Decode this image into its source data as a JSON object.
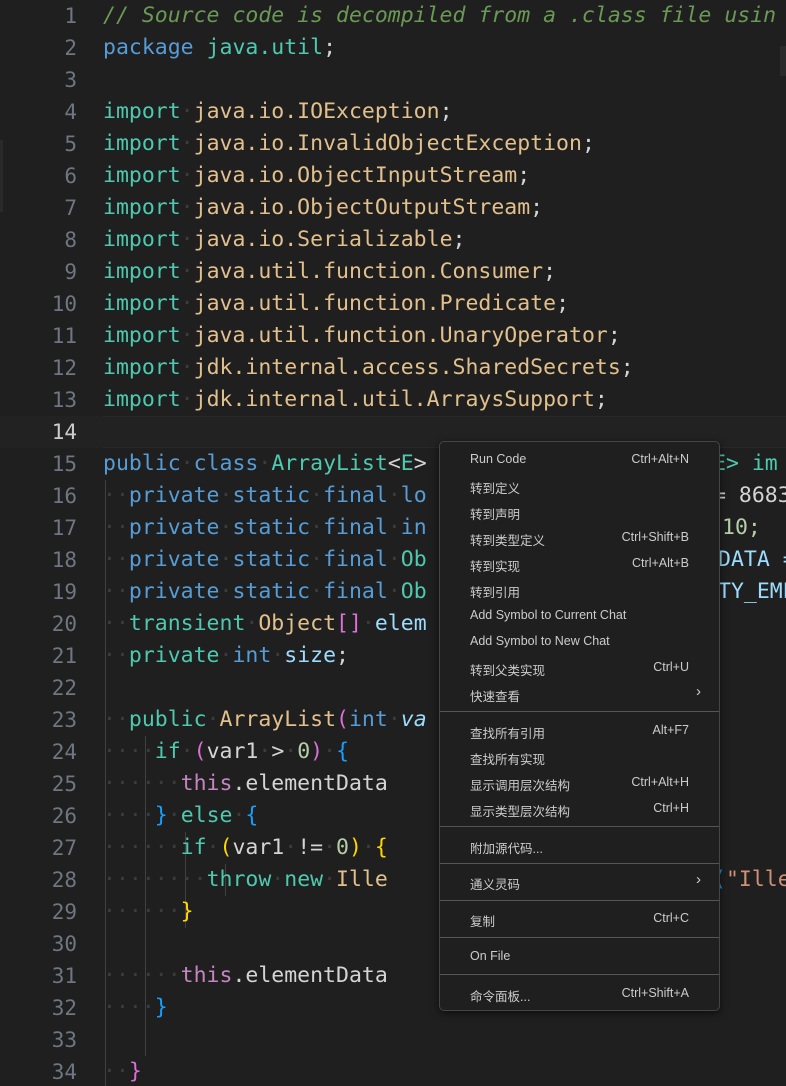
{
  "editor": {
    "line_numbers": [
      "1",
      "2",
      "3",
      "4",
      "5",
      "6",
      "7",
      "8",
      "9",
      "10",
      "11",
      "12",
      "13",
      "14",
      "15",
      "16",
      "17",
      "18",
      "19",
      "20",
      "21",
      "22",
      "23",
      "24",
      "25",
      "26",
      "27",
      "28",
      "29",
      "30",
      "31",
      "32",
      "33",
      "34"
    ],
    "current_line": "14",
    "code": {
      "l1": "// Source code is decompiled from a .class file usin",
      "pkg_kw": "package",
      "pkg_name": "java.util",
      "semi": ";",
      "import_kw": "import",
      "imports": [
        "java.io.IOException",
        "java.io.InvalidObjectException",
        "java.io.ObjectInputStream",
        "java.io.ObjectOutputStream",
        "java.io.Serializable",
        "java.util.function.Consumer",
        "java.util.function.Predicate",
        "java.util.function.UnaryOperator",
        "jdk.internal.access.SharedSecrets",
        "jdk.internal.util.ArraysSupport"
      ],
      "public": "public",
      "class": "class",
      "class_name": "ArrayList",
      "lt": "<",
      "E": "E",
      "gt": ">",
      "tail15": "E> im",
      "private": "private",
      "static": "static",
      "final": "final",
      "l16_type": "lo",
      "l16_tail": "= 8683",
      "l17_type": "in",
      "l17_tail": "10;",
      "l18_type": "Ob",
      "l18_tail": "DATA =",
      "l19_type": "Ob",
      "l19_tail": "TY_EMP",
      "transient": "transient",
      "object": "Object",
      "brackets": "[]",
      "elem": "elem",
      "int": "int",
      "size": "size",
      "ctor": "ArrayList",
      "paren_open": "(",
      "va": "va",
      "if": "if",
      "var1": "var1",
      "gt_op": ">",
      "zero": "0",
      "close_paren": ")",
      "brace_open": "{",
      "brace_close": "}",
      "this": "this",
      "element_data": ".elementData",
      "else": "else",
      "ne_op": "!=",
      "throw": "throw",
      "new": "new",
      "ille": "Ille",
      "tail28_br": "(",
      "tail28_str": "\"Ille"
    }
  },
  "context_menu": {
    "items": [
      {
        "label": "Run Code",
        "shortcut": "Ctrl+Alt+N"
      },
      {
        "label": "转到定义",
        "shortcut": ""
      },
      {
        "label": "转到声明",
        "shortcut": ""
      },
      {
        "label": "转到类型定义",
        "shortcut": "Ctrl+Shift+B"
      },
      {
        "label": "转到实现",
        "shortcut": "Ctrl+Alt+B"
      },
      {
        "label": "转到引用",
        "shortcut": ""
      },
      {
        "label": "Add Symbol to Current Chat",
        "shortcut": ""
      },
      {
        "label": "Add Symbol to New Chat",
        "shortcut": ""
      },
      {
        "label": "转到父类实现",
        "shortcut": "Ctrl+U"
      },
      {
        "label": "快速查看",
        "shortcut": ""
      },
      {
        "label": "查找所有引用",
        "shortcut": "Alt+F7"
      },
      {
        "label": "查找所有实现",
        "shortcut": ""
      },
      {
        "label": "显示调用层次结构",
        "shortcut": "Ctrl+Alt+H"
      },
      {
        "label": "显示类型层次结构",
        "shortcut": "Ctrl+H"
      },
      {
        "label": "附加源代码...",
        "shortcut": ""
      },
      {
        "label": "通义灵码",
        "shortcut": ""
      },
      {
        "label": "复制",
        "shortcut": "Ctrl+C"
      },
      {
        "label": "On File",
        "shortcut": ""
      },
      {
        "label": "命令面板...",
        "shortcut": "Ctrl+Shift+A"
      }
    ]
  },
  "colors": {
    "background": "#1f1f1f",
    "keyword": "#569cd6",
    "type": "#4ec9b0",
    "string": "#ce9178",
    "comment": "#6a9955"
  }
}
